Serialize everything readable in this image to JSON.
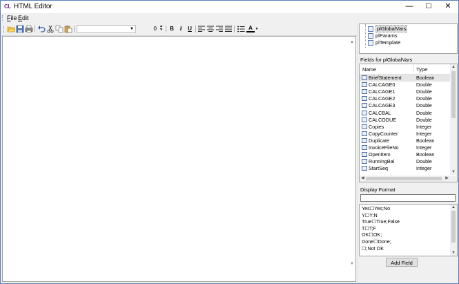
{
  "window": {
    "app_icon_text": "CL",
    "title": "HTML Editor",
    "minimize_glyph": "—",
    "maximize_glyph": "☐",
    "close_glyph": "✕"
  },
  "menu": {
    "items": [
      {
        "label": "File",
        "mnemonic": "F"
      },
      {
        "label": "Edit",
        "mnemonic": "E"
      }
    ]
  },
  "toolbar": {
    "font_name": "",
    "font_size": "0",
    "bold_label": "B",
    "italic_label": "I",
    "underline_label": "U",
    "font_color_label": "A",
    "icons": [
      "open-icon",
      "save-icon",
      "print-icon",
      "undo-icon",
      "cut-icon",
      "copy-icon",
      "paste-icon",
      "bold-icon",
      "italic-icon",
      "underline-icon",
      "align-left-icon",
      "align-center-icon",
      "align-right-icon",
      "justify-icon",
      "bullet-list-icon",
      "font-color-icon"
    ]
  },
  "tree": {
    "items": [
      {
        "label": "plGlobalVars",
        "selected": true
      },
      {
        "label": "plParams",
        "selected": false
      },
      {
        "label": "plTemplate",
        "selected": false
      }
    ]
  },
  "fields": {
    "label": "Fields for plGlobalVars",
    "columns": {
      "name": "Name",
      "type": "Type"
    },
    "rows": [
      {
        "name": "BriefStatement",
        "type": "Boolean"
      },
      {
        "name": "CALCAGE0",
        "type": "Double"
      },
      {
        "name": "CALCAGE1",
        "type": "Double"
      },
      {
        "name": "CALCAGE2",
        "type": "Double"
      },
      {
        "name": "CALCAGE3",
        "type": "Double"
      },
      {
        "name": "CALCBAL",
        "type": "Double"
      },
      {
        "name": "CALCODUE",
        "type": "Double"
      },
      {
        "name": "Copies",
        "type": "Integer"
      },
      {
        "name": "CopyCounter",
        "type": "Integer"
      },
      {
        "name": "Duplicate",
        "type": "Boolean"
      },
      {
        "name": "InvoiceFileNo",
        "type": "Integer"
      },
      {
        "name": "OpenItem",
        "type": "Boolean"
      },
      {
        "name": "RunningBal",
        "type": "Double"
      },
      {
        "name": "StartSeq",
        "type": "Integer"
      }
    ]
  },
  "display_format": {
    "label": "Display Format",
    "value": "",
    "options": [
      "Yes☐Yes;No",
      "Y☐Y;N",
      "True☐True;False",
      "T☐T;F",
      "OK☐OK;",
      "Done☐Done;",
      "☐;Not OK"
    ]
  },
  "add_field_label": "Add Field",
  "colors": {
    "window_border": "#5a7fb5",
    "selection": "#e5e5e5",
    "chrome": "#f0f0f0",
    "app_icon": "#7b2a8c"
  }
}
